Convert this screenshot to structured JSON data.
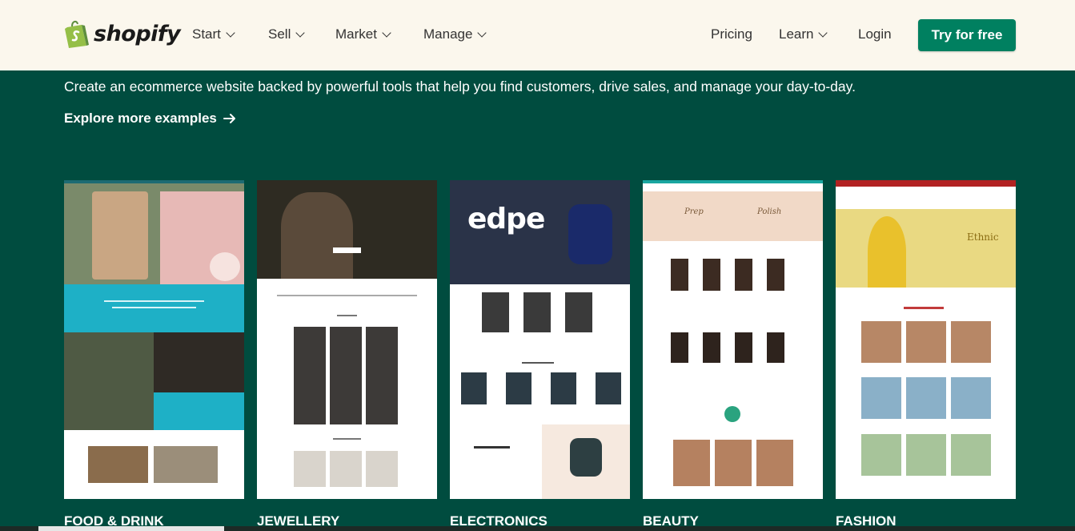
{
  "header": {
    "brand": "shopify",
    "nav_left": [
      {
        "label": "Start"
      },
      {
        "label": "Sell"
      },
      {
        "label": "Market"
      },
      {
        "label": "Manage"
      }
    ],
    "nav_right": {
      "pricing": "Pricing",
      "learn": "Learn",
      "login": "Login",
      "cta": "Try for free"
    }
  },
  "hero": {
    "tagline": "Create an ecommerce website backed by powerful tools that help you find customers, drive sales, and manage your day-to-day.",
    "explore_link": "Explore more examples"
  },
  "examples": [
    {
      "category": "FOOD & DRINK"
    },
    {
      "category": "JEWELLERY"
    },
    {
      "category": "ELECTRONICS",
      "hero_text": "edpe"
    },
    {
      "category": "BEAUTY",
      "hero_words": [
        "Prep",
        "Polish"
      ]
    },
    {
      "category": "FASHION",
      "hero_text": "Ethnic"
    }
  ],
  "colors": {
    "background": "#004c3f",
    "header_bg": "#fbf7ed",
    "cta": "#008060"
  }
}
